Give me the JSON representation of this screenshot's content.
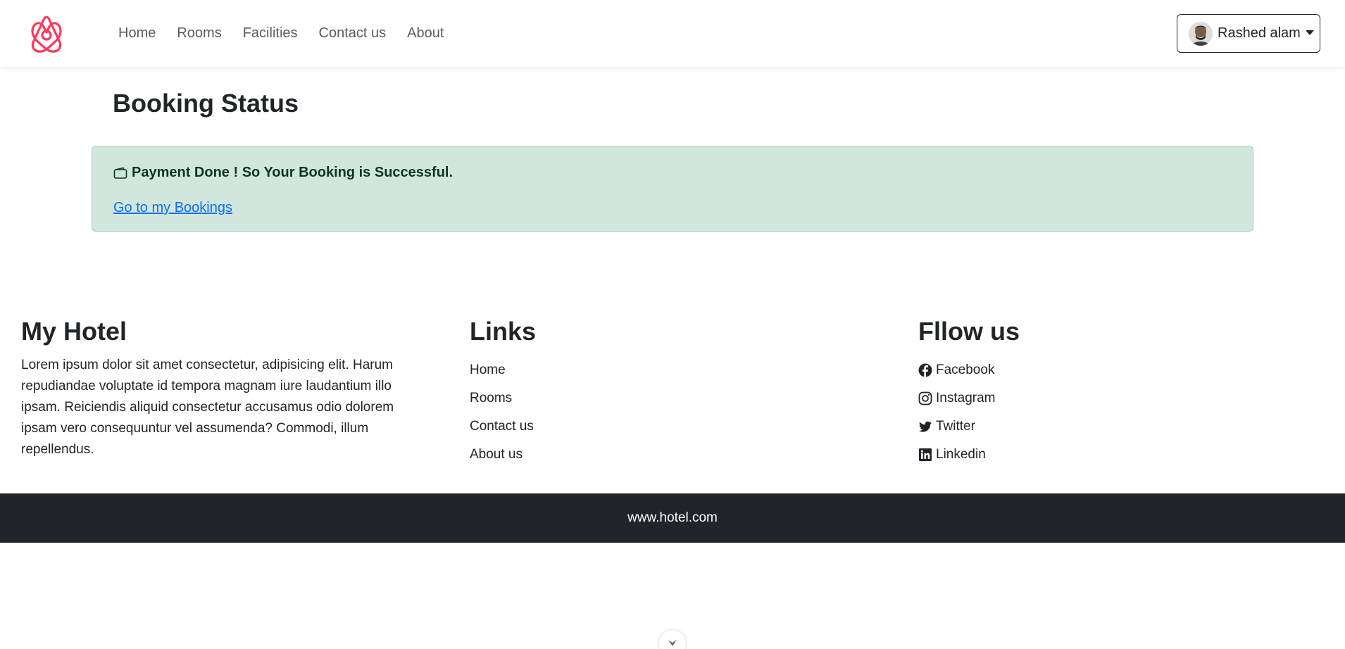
{
  "colors": {
    "brand": "#ff385c",
    "alert_bg": "#d1e7dd",
    "footer_bar": "#212529",
    "link": "#0d6efd"
  },
  "nav": {
    "items": [
      {
        "label": "Home"
      },
      {
        "label": "Rooms"
      },
      {
        "label": "Facilities"
      },
      {
        "label": "Contact us"
      },
      {
        "label": "About"
      }
    ],
    "user": {
      "name": "Rashed alam",
      "icon": "avatar"
    }
  },
  "main": {
    "title": "Booking Status",
    "alert": {
      "icon": "wallet-icon",
      "message": "Payment Done ! So Your Booking is Successful.",
      "link": "Go to my Bookings"
    }
  },
  "footer": {
    "about": {
      "heading": "My Hotel",
      "text": "Lorem ipsum dolor sit amet consectetur, adipisicing elit. Harum repudiandae voluptate id tempora magnam iure laudantium illo ipsam. Reiciendis aliquid consectetur accusamus odio dolorem ipsam vero consequuntur vel assumenda? Commodi, illum repellendus."
    },
    "links": {
      "heading": "Links",
      "items": [
        {
          "label": "Home"
        },
        {
          "label": "Rooms"
        },
        {
          "label": "Contact us"
        },
        {
          "label": "About us"
        }
      ]
    },
    "social": {
      "heading": "Fllow us",
      "items": [
        {
          "label": "Facebook",
          "icon": "facebook-icon"
        },
        {
          "label": "Instagram",
          "icon": "instagram-icon"
        },
        {
          "label": "Twitter",
          "icon": "twitter-icon"
        },
        {
          "label": "Linkedin",
          "icon": "linkedin-icon"
        }
      ]
    },
    "bottom_text": "www.hotel.com"
  }
}
